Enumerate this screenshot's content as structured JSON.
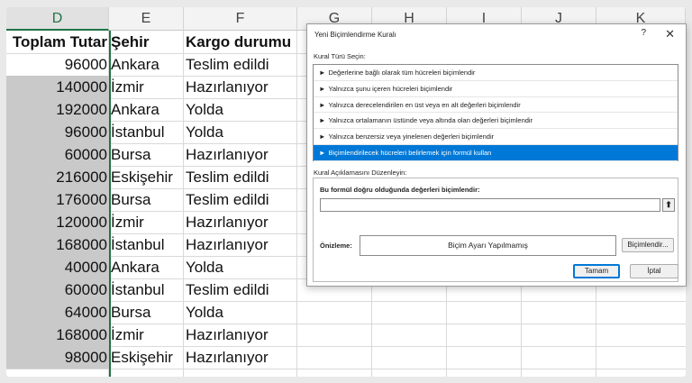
{
  "columns": [
    "D",
    "E",
    "F",
    "G",
    "H",
    "I",
    "J",
    "K"
  ],
  "table": {
    "headers": [
      "Toplam Tutar",
      "Şehir",
      "Kargo durumu"
    ],
    "rows": [
      [
        "96000",
        "Ankara",
        "Teslim edildi"
      ],
      [
        "140000",
        "İzmir",
        "Hazırlanıyor"
      ],
      [
        "192000",
        "Ankara",
        "Yolda"
      ],
      [
        "96000",
        "İstanbul",
        "Yolda"
      ],
      [
        "60000",
        "Bursa",
        "Hazırlanıyor"
      ],
      [
        "216000",
        "Eskişehir",
        "Teslim edildi"
      ],
      [
        "176000",
        "Bursa",
        "Teslim edildi"
      ],
      [
        "120000",
        "İzmir",
        "Hazırlanıyor"
      ],
      [
        "168000",
        "İstanbul",
        "Hazırlanıyor"
      ],
      [
        "40000",
        "Ankara",
        "Yolda"
      ],
      [
        "60000",
        "İstanbul",
        "Teslim edildi"
      ],
      [
        "64000",
        "Bursa",
        "Yolda"
      ],
      [
        "168000",
        "İzmir",
        "Hazırlanıyor"
      ],
      [
        "98000",
        "Eskişehir",
        "Hazırlanıyor"
      ]
    ]
  },
  "dialog": {
    "title": "Yeni Biçimlendirme Kuralı",
    "help": "?",
    "close": "✕",
    "rule_type_label": "Kural Türü Seçin:",
    "rule_types": [
      "Değerlerine bağlı olarak tüm hücreleri biçimlendir",
      "Yalnızca şunu içeren hücreleri biçimlendir",
      "Yalnızca derecelendirilen en üst veya en alt değerleri biçimlendir",
      "Yalnızca ortalamanın üstünde veya altında olan değerleri biçimlendir",
      "Yalnızca benzersiz veya yinelenen değerleri biçimlendir",
      "Biçimlendirilecek hücreleri belirlemek için formül kullan"
    ],
    "selected_rule_index": 5,
    "rule_arrow": "►",
    "description_label": "Kural Açıklamasını Düzenleyin:",
    "formula_label": "Bu formül doğru olduğunda değerleri biçimlendir:",
    "formula_value": "",
    "collapse_glyph": "⬆",
    "preview_label": "Önizleme:",
    "preview_text": "Biçim Ayarı Yapılmamış",
    "format_button": "Biçimlendir...",
    "ok_button": "Tamam",
    "cancel_button": "İptal"
  },
  "colors": {
    "accent_green": "#217346",
    "selection_blue": "#0078d7",
    "selected_cell_gray": "#c9c9c9"
  }
}
